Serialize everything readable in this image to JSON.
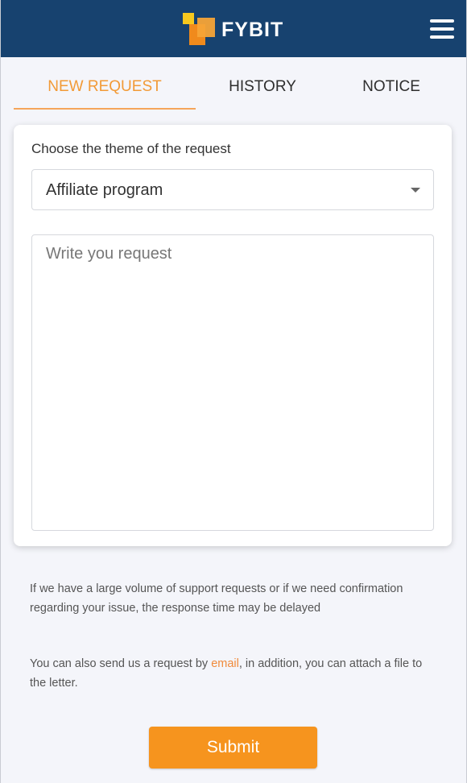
{
  "header": {
    "brand": "FYBIT",
    "menu_icon": "hamburger-icon",
    "background_color": "#17426f"
  },
  "tabs": [
    {
      "label": "NEW REQUEST",
      "active": true
    },
    {
      "label": "HISTORY",
      "active": false
    },
    {
      "label": "NOTICE",
      "active": false
    }
  ],
  "form": {
    "theme_label": "Choose the theme of the request",
    "theme_selected": "Affiliate program",
    "request_placeholder": "Write you request",
    "request_value": ""
  },
  "info": {
    "delay_notice": "If we have a large volume of support requests or if we need confirmation regarding your issue, the response time may be delayed",
    "email_prefix": "You can also send us a request by ",
    "email_link": "email",
    "email_suffix": ", in addition, you can attach a file to the letter."
  },
  "submit_label": "Submit",
  "colors": {
    "accent": "#f6941e",
    "active_tab": "#f29a36",
    "link": "#f08a3a"
  }
}
